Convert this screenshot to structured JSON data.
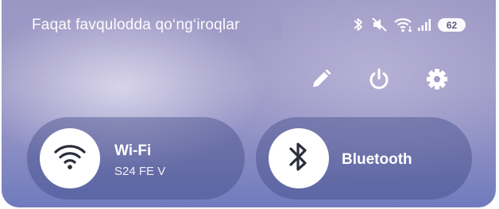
{
  "status_bar": {
    "message": "Faqat favqulodda qo‘ng‘iroqlar",
    "icons": [
      "bluetooth-icon",
      "mute-icon",
      "wifi-icon",
      "signal-icon"
    ],
    "battery_level": "62"
  },
  "actions": [
    {
      "name": "edit-icon"
    },
    {
      "name": "power-icon"
    },
    {
      "name": "settings-icon"
    }
  ],
  "tiles": {
    "wifi": {
      "label": "Wi-Fi",
      "network": "S24 FE V",
      "icon": "wifi-icon",
      "active": true
    },
    "bluetooth": {
      "label": "Bluetooth",
      "icon": "bluetooth-icon",
      "active": true
    }
  }
}
